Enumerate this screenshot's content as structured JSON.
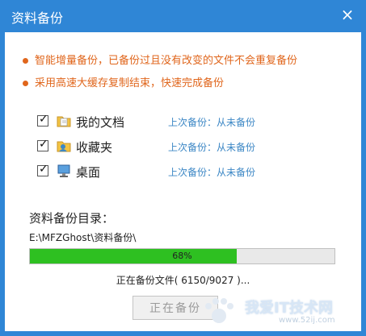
{
  "window": {
    "title": "资料备份",
    "close_glyph": "×"
  },
  "tips": [
    "智能增量备份，已备份过且没有改变的文件不会重复备份",
    "采用高速大缓存复制结束，快速完成备份"
  ],
  "items": [
    {
      "label": "我的文档",
      "checked": true,
      "icon": "documents-folder-icon",
      "status": "上次备份：从未备份"
    },
    {
      "label": "收藏夹",
      "checked": true,
      "icon": "favorites-folder-icon",
      "status": "上次备份：从未备份"
    },
    {
      "label": "桌面",
      "checked": true,
      "icon": "desktop-icon",
      "status": "上次备份：从未备份"
    }
  ],
  "backup_dir": {
    "label": "资料备份目录：",
    "path": "E:\\MFZGhost\\资料备份\\"
  },
  "progress": {
    "percent": 68,
    "percent_text": "68%",
    "status_text": "正在备份文件( 6150/9027 )..."
  },
  "button": {
    "label": "正在备份",
    "enabled": false
  },
  "watermark": {
    "text": "我爱IT技术网",
    "url": "www.52ij.com"
  },
  "colors": {
    "titlebar": "#2f86d6",
    "tip": "#e0661c",
    "status": "#3c87c5",
    "progress_fill": "#2ec021"
  }
}
